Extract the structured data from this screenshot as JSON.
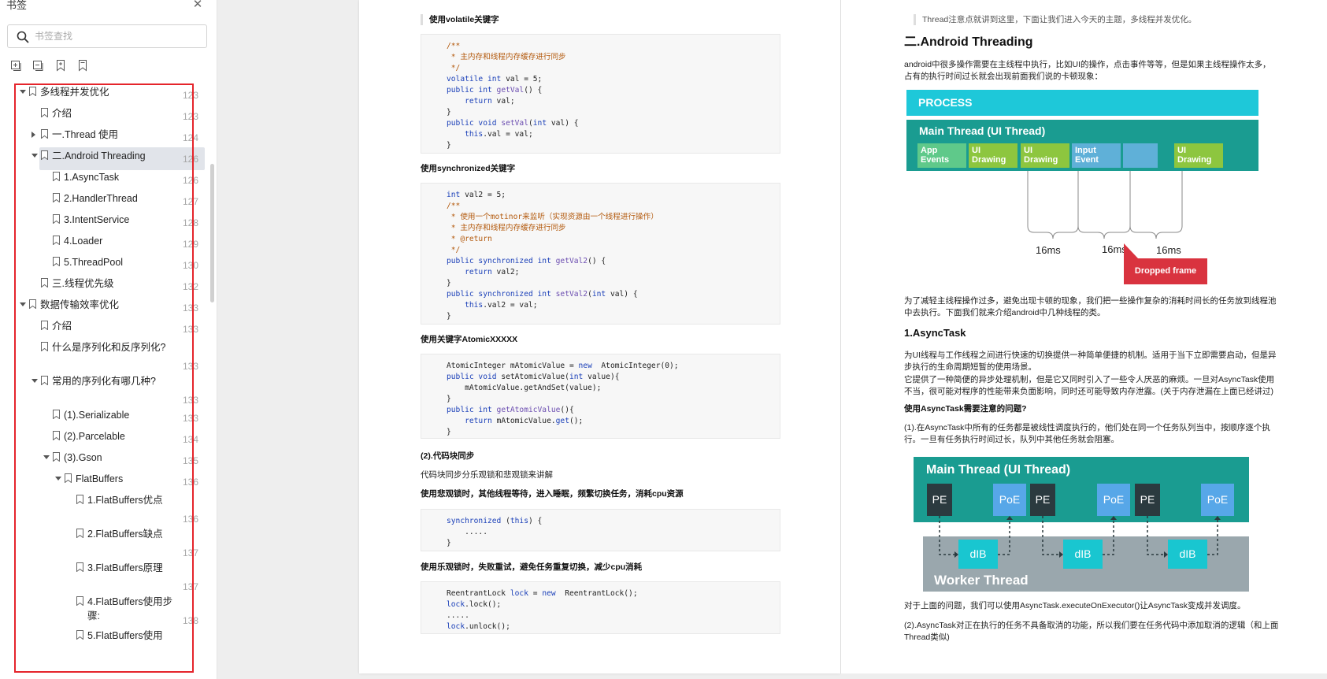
{
  "sidebar": {
    "title": "书签",
    "search_placeholder": "书签查找",
    "tools": [
      "expand-all-icon",
      "collapse-all-icon",
      "add-bookmark-icon",
      "bookmark-icon"
    ],
    "items": [
      {
        "label": "多线程并发优化",
        "page": "123"
      },
      {
        "label": "介绍",
        "page": "123"
      },
      {
        "label": "一.Thread 使用",
        "page": "124"
      },
      {
        "label": "二.Android Threading",
        "page": "126"
      },
      {
        "label": "1.AsyncTask",
        "page": "126"
      },
      {
        "label": "2.HandlerThread",
        "page": "127"
      },
      {
        "label": "3.IntentService",
        "page": "128"
      },
      {
        "label": "4.Loader",
        "page": "129"
      },
      {
        "label": "5.ThreadPool",
        "page": "130"
      },
      {
        "label": "三.线程优先级",
        "page": "132"
      },
      {
        "label": "数据传输效率优化",
        "page": "133"
      },
      {
        "label": "介绍",
        "page": "133"
      },
      {
        "label": "什么是序列化和反序列化?",
        "page": "133"
      },
      {
        "label": "常用的序列化有哪几种?",
        "page": "133"
      },
      {
        "label": "(1).Serializable",
        "page": "133"
      },
      {
        "label": "(2).Parcelable",
        "page": "134"
      },
      {
        "label": "(3).Gson",
        "page": "135"
      },
      {
        "label": "FlatBuffers",
        "page": "136"
      },
      {
        "label": "1.FlatBuffers优点",
        "page": "136"
      },
      {
        "label": "2.FlatBuffers缺点",
        "page": "137"
      },
      {
        "label": "3.FlatBuffers原理",
        "page": "137"
      },
      {
        "label": "4.FlatBuffers使用步骤:",
        "page": "138"
      },
      {
        "label": "5.FlatBuffers使用",
        "page": ""
      }
    ]
  },
  "left_page": {
    "note": "使用volatile关键字",
    "code1": [
      "/**",
      " * 主内存和线程内存缓存进行同步",
      " */",
      "volatile int val = 5;",
      "public int getVal() {",
      "    return val;",
      "}",
      "public void setVal(int val) {",
      "    this.val = val;",
      "}"
    ],
    "h_sync": "使用synchronized关键字",
    "code2": [
      "int val2 = 5;",
      "/**",
      " * 使用一个motinor来监听（实现资源由一个线程进行操作）",
      " * 主内存和线程内存缓存进行同步",
      " * @return",
      " */",
      "public synchronized int getVal2() {",
      "    return val2;",
      "}",
      "public synchronized int setVal2(int val) {",
      "    this.val2 = val;",
      "}"
    ],
    "h_atomic": "使用关键字AtomicXXXXX",
    "code3": [
      "AtomicInteger mAtomicValue = new  AtomicInteger(0);",
      "public void setAtomicValue(int value){",
      "    mAtomicValue.getAndSet(value);",
      "}",
      "public int getAtomicValue(){",
      "    return mAtomicValue.get();",
      "}"
    ],
    "h_block": "(2).代码块同步",
    "t_block": "代码块同步分乐观锁和悲观锁来讲解",
    "h_pess": "使用悲观锁时，其他线程等待，进入睡眠，频繁切换任务，消耗cpu资源",
    "code4": [
      "synchronized (this) {",
      "    .....",
      "}"
    ],
    "h_opt": "使用乐观锁时，失败重试，避免任务重复切换，减少cpu消耗",
    "code5": [
      "ReentrantLock lock = new  ReentrantLock();",
      "lock.lock();",
      ".....",
      "lock.unlock();"
    ]
  },
  "right_page": {
    "note": "Thread注意点就讲到这里，下面让我们进入今天的主题，多线程并发优化。",
    "h2": "二.Android Threading",
    "p1a": "android中很多操作需要在主线程中执行，比如UI的操作，点击事件等等，但是如果主线程操作太多，",
    "p1b": "占有的执行时间过长就会出现前面我们说的卡顿现象：",
    "fig1": {
      "process": "PROCESS",
      "main": "Main Thread (UI Thread)",
      "blocks": [
        {
          "l1": "App",
          "l2": "Events",
          "color": "#5fc98a"
        },
        {
          "l1": "UI",
          "l2": "Drawing",
          "color": "#8dc63f"
        },
        {
          "l1": "UI",
          "l2": "Drawing",
          "color": "#8dc63f"
        },
        {
          "l1": "Input",
          "l2": "Event",
          "color": "#5fb0d8"
        },
        {
          "l1": "",
          "l2": "",
          "color": "#5fb0d8"
        },
        {
          "l1": "UI",
          "l2": "Drawing",
          "color": "#8dc63f"
        }
      ],
      "ms": [
        "16ms",
        "16ms",
        "16ms"
      ],
      "dropped": "Dropped frame"
    },
    "p2a": "为了减轻主线程操作过多，避免出现卡顿的现象，我们把一些操作复杂的消耗时间长的任务放到线程池",
    "p2b": "中去执行。下面我们就来介绍android中几种线程的类。",
    "h3": "1.AsyncTask",
    "p3a": "为UI线程与工作线程之间进行快速的切换提供一种简单便捷的机制。适用于当下立即需要启动，但是异",
    "p3b": "步执行的生命周期短暂的使用场景。",
    "p3c": " 它提供了一种简便的异步处理机制，但是它又同时引入了一些令人厌恶的麻烦。一旦对AsyncTask使用",
    "p3d": "不当，很可能对程序的性能带来负面影响，同时还可能导致内存泄露。(关于内存泄漏在上面已经讲过)",
    "h_issue": "使用AsyncTask需要注意的问题?",
    "p4a": "(1).在AsyncTask中所有的任务都是被线性调度执行的，他们处在同一个任务队列当中，按顺序逐个执",
    "p4b": "行。一旦有任务执行时间过长，队列中其他任务就会阻塞。",
    "fig2": {
      "main": "Main Thread (UI Thread)",
      "worker": "Worker Thread",
      "pe": "PE",
      "poe": "PoE",
      "dib": "dIB"
    },
    "p5": "对于上面的问题，我们可以使用AsyncTask.executeOnExecutor()让AsyncTask变成并发调度。",
    "p6a": "(2).AsyncTask对正在执行的任务不具备取消的功能，所以我们要在任务代码中添加取消的逻辑（和上面",
    "p6b": "Thread类似)"
  }
}
